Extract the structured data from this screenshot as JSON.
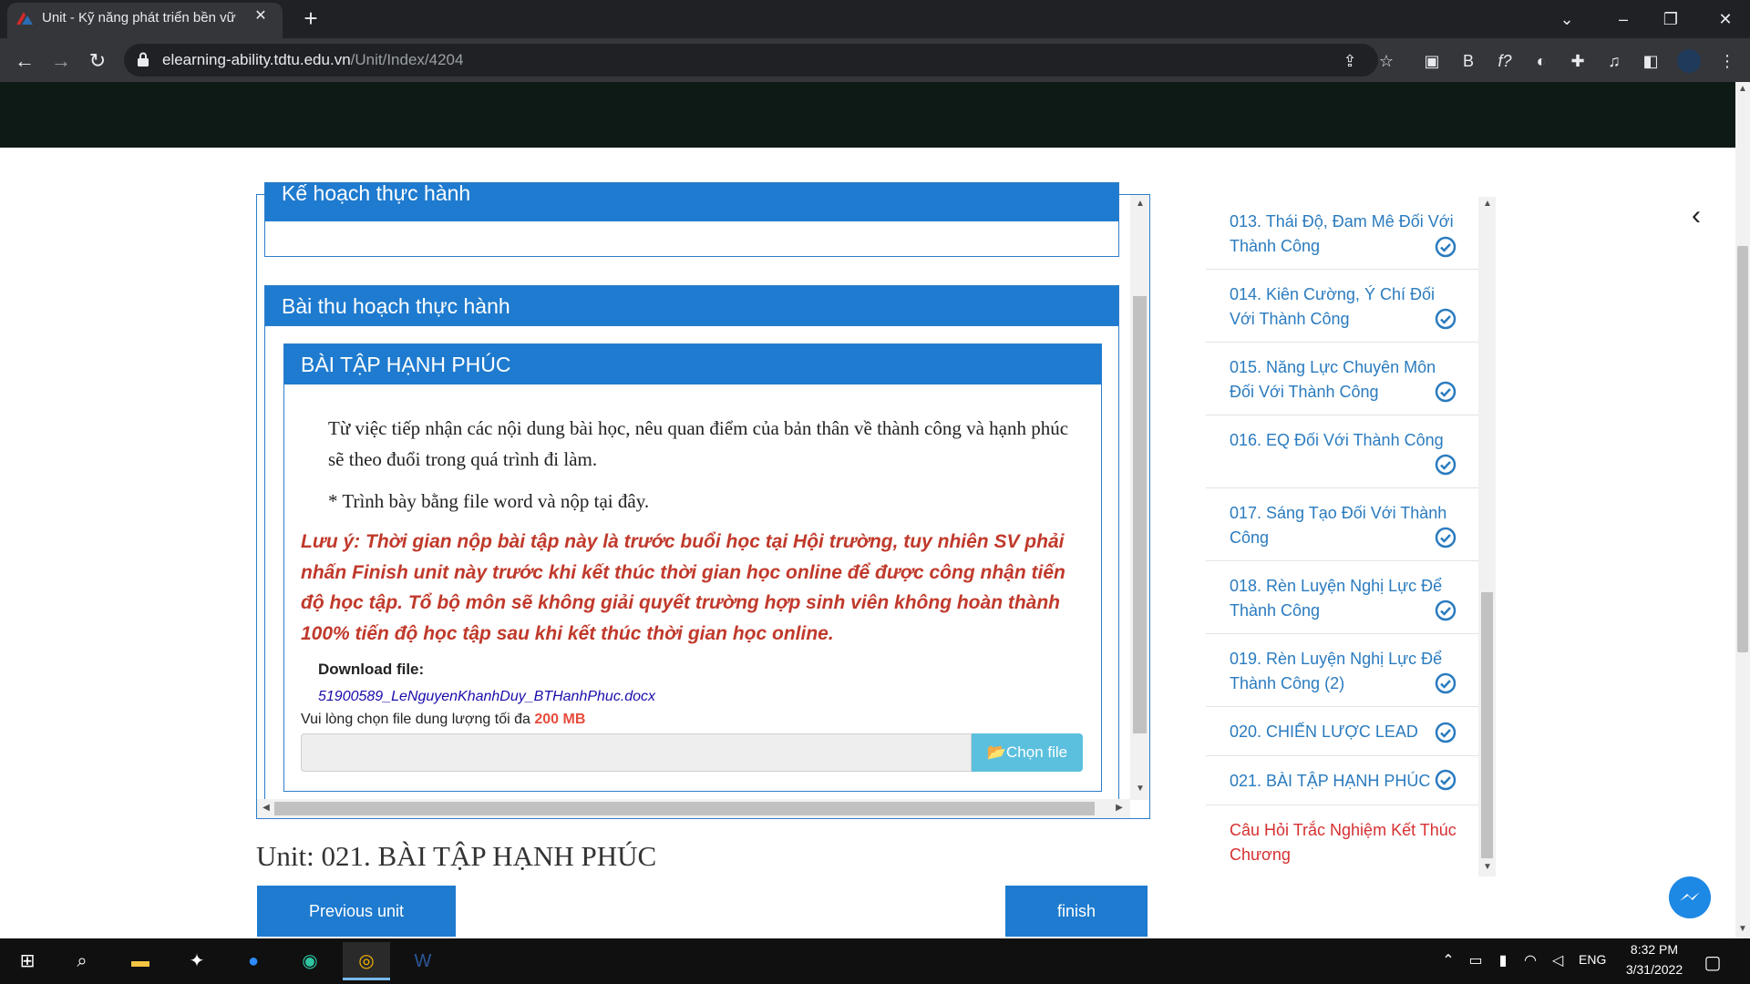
{
  "browser": {
    "tab_title": "Unit - Kỹ năng phát triển bền vữ",
    "url_host": "elearning-ability.tdtu.edu.vn",
    "url_path": "/Unit/Index/4204",
    "icons": [
      "back-icon",
      "forward-icon",
      "reload-icon",
      "lock-icon",
      "share-icon",
      "star-icon",
      "extension-icon",
      "profile-icon",
      "menu-icon"
    ]
  },
  "content": {
    "panel1_title": "Kế hoạch thực hành",
    "panel2_title": "Bài thu hoạch thực hành",
    "panel3_title": "BÀI TẬP HẠNH PHÚC",
    "para1": "Từ việc tiếp nhận các nội dung bài học, nêu quan điểm của bản thân về thành công và hạnh phúc sẽ theo đuổi trong quá trình đi làm.",
    "para2": "* Trình bày bằng file word và nộp tại đây.",
    "note": "Lưu ý: Thời gian nộp bài tập này là trước buổi học tại Hội trường, tuy nhiên SV phải nhấn Finish unit này trước khi kết thúc thời gian học online để được công nhận tiến độ học tập. Tổ bộ môn sẽ không giải quyết trường hợp sinh viên không hoàn thành 100% tiến độ học tập sau khi kết thúc thời gian học online.",
    "download_label": "Download file:",
    "download_file": "51900589_LeNguyenKhanhDuy_BTHanhPhuc.docx",
    "size_hint": "Vui lòng chọn file dung lượng tối đa ",
    "size_limit": "200 MB",
    "choose_file": "Chọn file"
  },
  "unit_title": "Unit: 021. BÀI TẬP HẠNH PHÚC",
  "buttons": {
    "previous": "Previous unit",
    "finish": "finish"
  },
  "sidebar": {
    "items": [
      {
        "label": "013. Thái Độ, Đam Mê Đối Với Thành Công",
        "completed": true
      },
      {
        "label": "014. Kiên Cường, Ý Chí Đối Với Thành Công",
        "completed": true
      },
      {
        "label": "015. Năng Lực Chuyên Môn Đối Với Thành Công",
        "completed": true
      },
      {
        "label": "016. EQ Đối Với Thành Công",
        "completed": true
      },
      {
        "label": "017. Sáng Tạo Đối Với Thành Công",
        "completed": true
      },
      {
        "label": "018. Rèn Luyện Nghị Lực Để Thành Công",
        "completed": true
      },
      {
        "label": "019. Rèn Luyện Nghị Lực Để Thành Công (2)",
        "completed": true
      },
      {
        "label": "020. CHIẾN LƯỢC LEAD",
        "completed": true
      },
      {
        "label": "021. BÀI TẬP HẠNH PHÚC",
        "completed": true
      },
      {
        "label": "Câu Hỏi Trắc Nghiệm Kết Thúc Chương",
        "completed": false
      }
    ],
    "accent": "#2a7bbf",
    "alert_color": "#d63031"
  },
  "taskbar": {
    "lang": "ENG",
    "time": "8:32 PM",
    "date": "3/31/2022"
  }
}
